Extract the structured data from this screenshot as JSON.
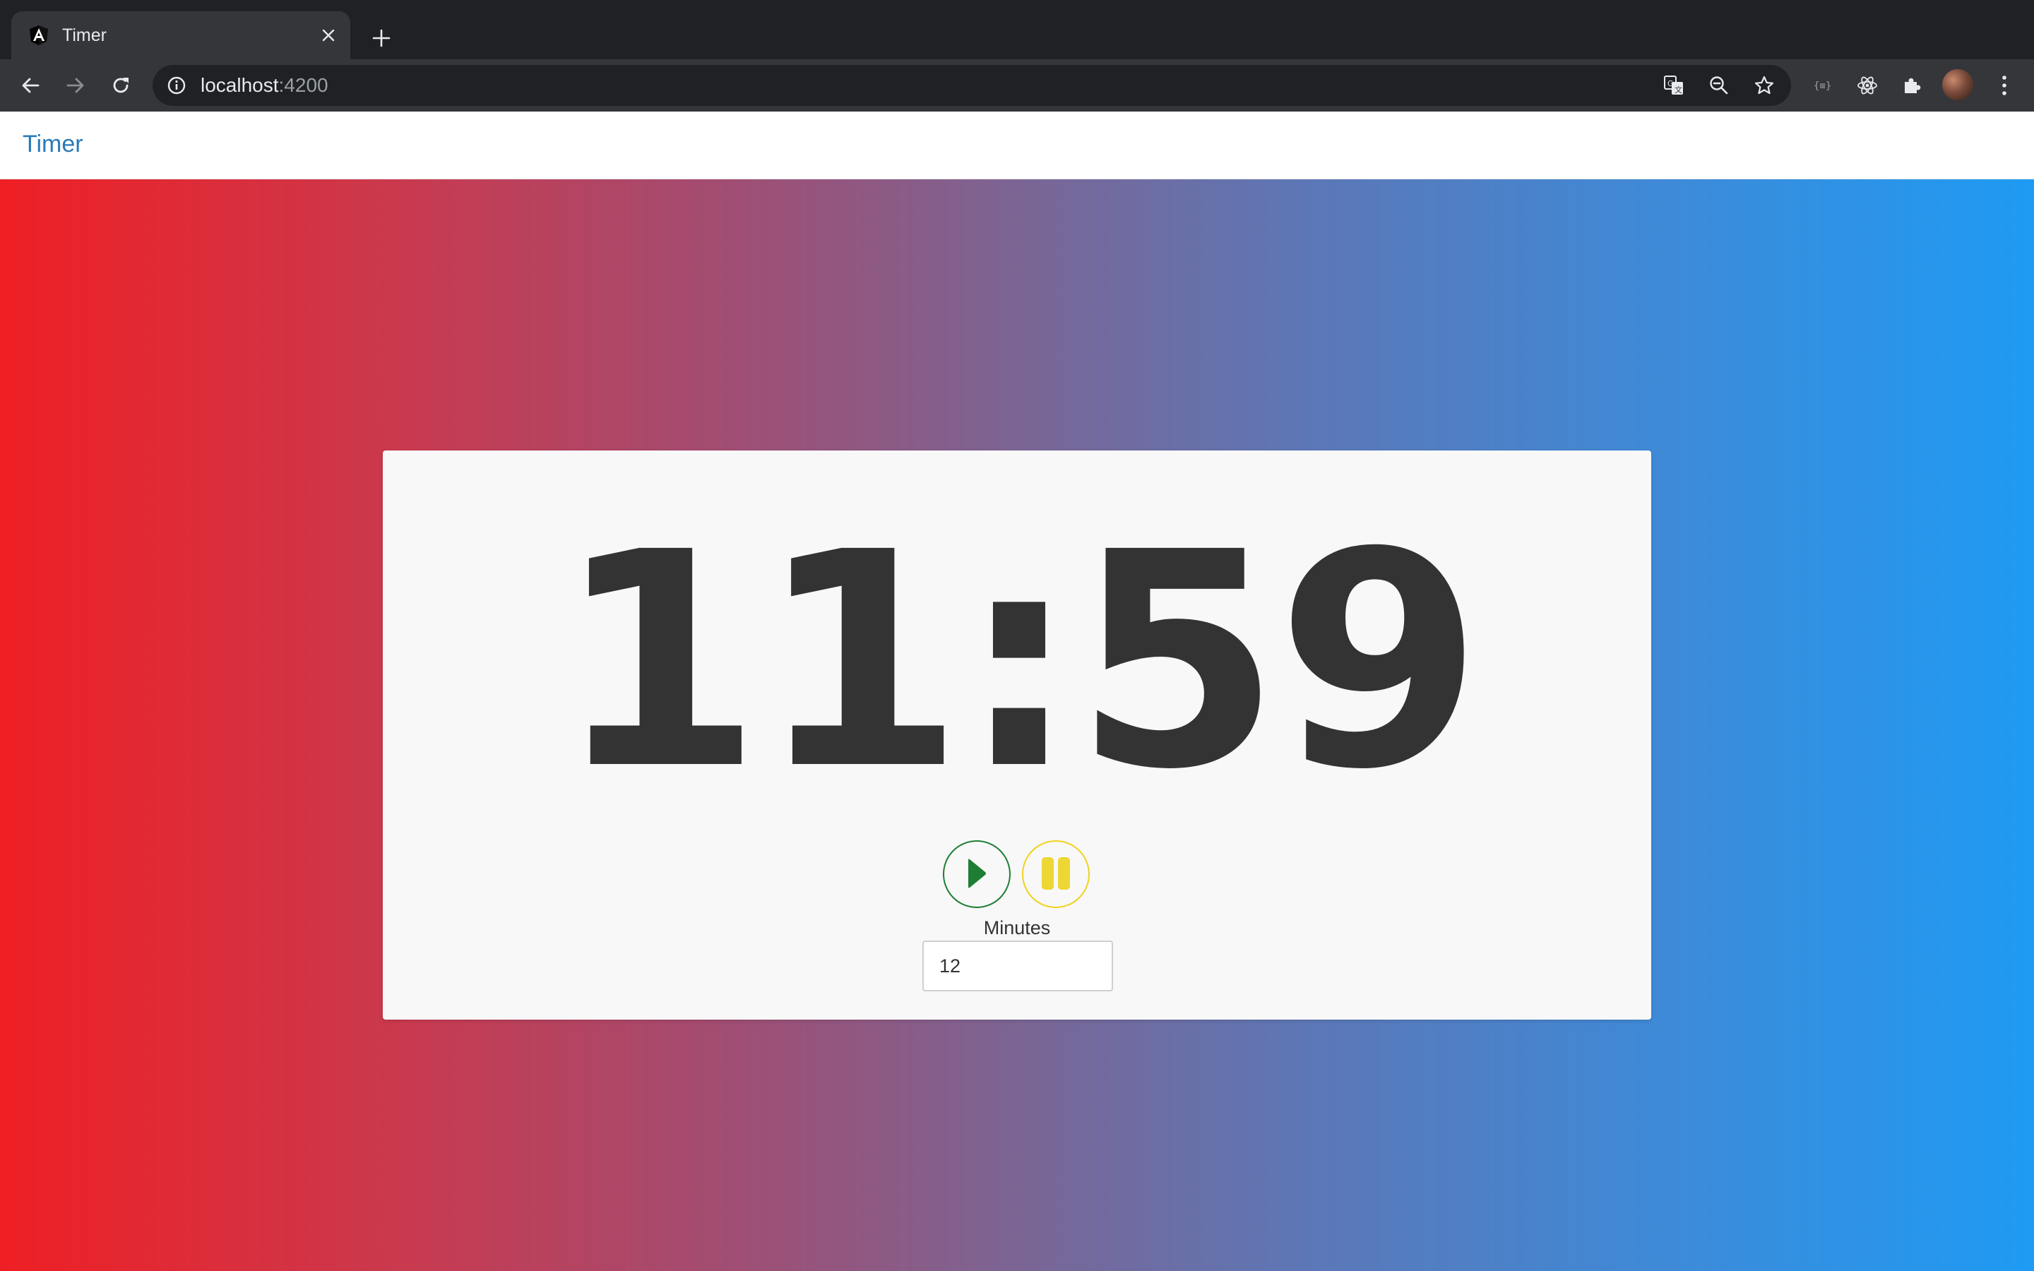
{
  "browser": {
    "tab": {
      "title": "Timer",
      "favicon": "angular-icon"
    },
    "address": {
      "host": "localhost",
      "port": ":4200"
    },
    "toolbar_icons": [
      "back-icon",
      "forward-icon",
      "reload-icon",
      "info-icon",
      "translate-icon",
      "zoom-out-icon",
      "bookmark-star-icon",
      "extension-braces-icon",
      "react-devtools-icon",
      "extensions-puzzle-icon",
      "profile-avatar",
      "menu-dots-icon"
    ]
  },
  "app": {
    "brand": "Timer",
    "timer": {
      "display": "11:59",
      "minutes_label": "Minutes",
      "minutes_value": "12"
    },
    "colors": {
      "brand": "#2a7ab8",
      "play": "#1e7e34",
      "pause": "#f0d21c",
      "gradient_start": "#ef1f24",
      "gradient_end": "#1e9bf3"
    }
  }
}
